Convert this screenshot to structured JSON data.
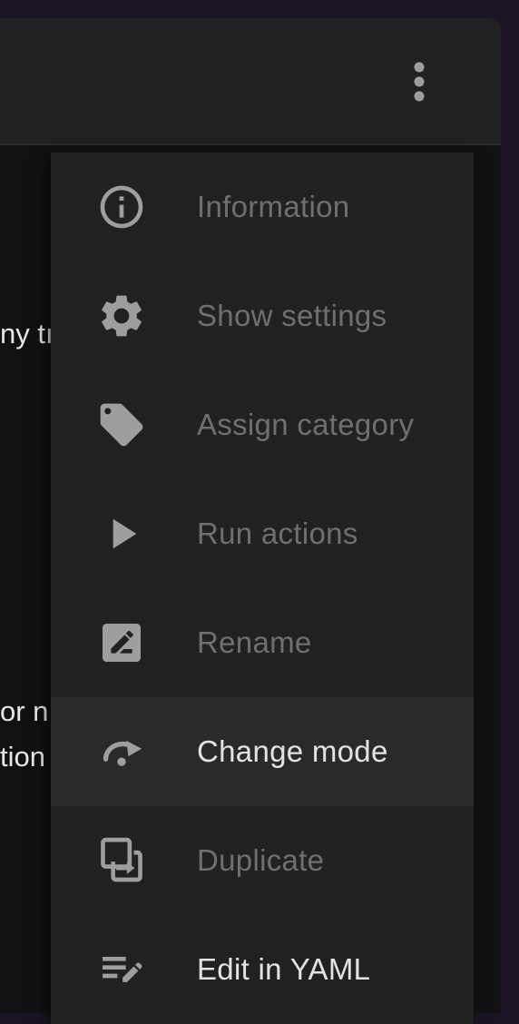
{
  "background": {
    "text_fragments": [
      "ny tı",
      "or n",
      "tion"
    ]
  },
  "toolbar": {
    "overflow_icon": "more-vertical-icon"
  },
  "menu": {
    "items": [
      {
        "label": "Information",
        "icon": "info-icon",
        "state": "disabled"
      },
      {
        "label": "Show settings",
        "icon": "gear-icon",
        "state": "disabled"
      },
      {
        "label": "Assign category",
        "icon": "tag-icon",
        "state": "disabled"
      },
      {
        "label": "Run actions",
        "icon": "play-icon",
        "state": "disabled"
      },
      {
        "label": "Rename",
        "icon": "rename-icon",
        "state": "disabled"
      },
      {
        "label": "Change mode",
        "icon": "change-mode-icon",
        "state": "highlighted"
      },
      {
        "label": "Duplicate",
        "icon": "duplicate-icon",
        "state": "disabled"
      },
      {
        "label": "Edit in YAML",
        "icon": "edit-yaml-icon",
        "state": "enabled"
      }
    ]
  },
  "colors": {
    "enabled_text": "#e3e3e3",
    "disabled_text": "#6f6f6f",
    "icon": "#9e9e9e",
    "menu_background": "#212121",
    "highlight_background": "#2a2a2a"
  }
}
